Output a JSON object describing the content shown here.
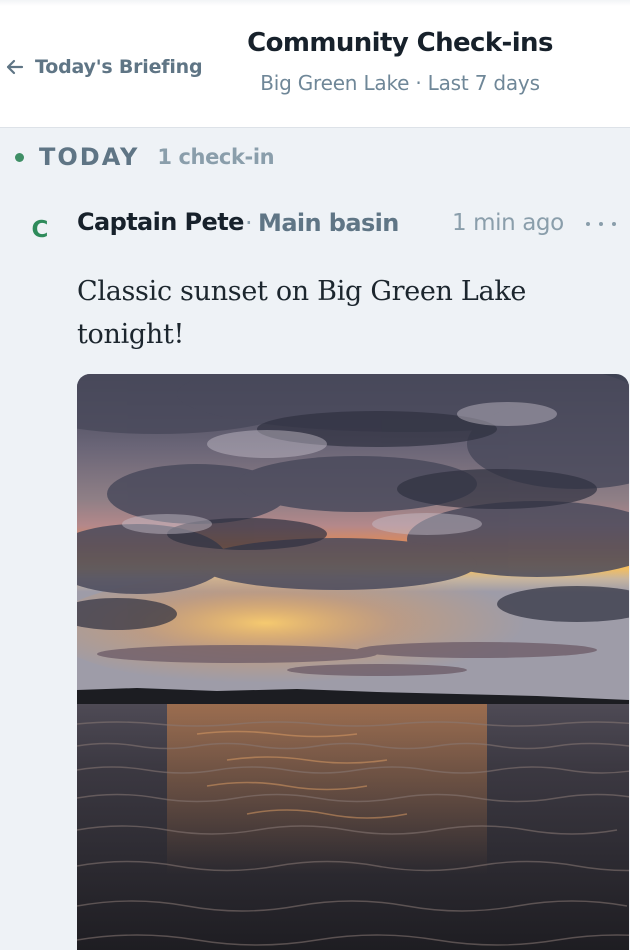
{
  "header": {
    "back_label": "Today's Briefing",
    "title": "Community Check-ins",
    "subtitle": "Big Green Lake · Last 7 days"
  },
  "feed": {
    "day": {
      "label": "TODAY",
      "count": "1 check-in"
    },
    "post": {
      "avatar_initial": "C",
      "author": "Captain Pete",
      "location": "Main basin",
      "time": "1 min ago",
      "text": "Classic sunset on Big Green Lake tonight!"
    }
  },
  "icons": {
    "back": "arrow-left-icon",
    "more": "more-horizontal-icon"
  },
  "colors": {
    "background": "#eef2f6",
    "accent_green": "#3f8f66",
    "slate": "#5f7585",
    "muted": "#8a9eab",
    "title": "#17212b"
  }
}
